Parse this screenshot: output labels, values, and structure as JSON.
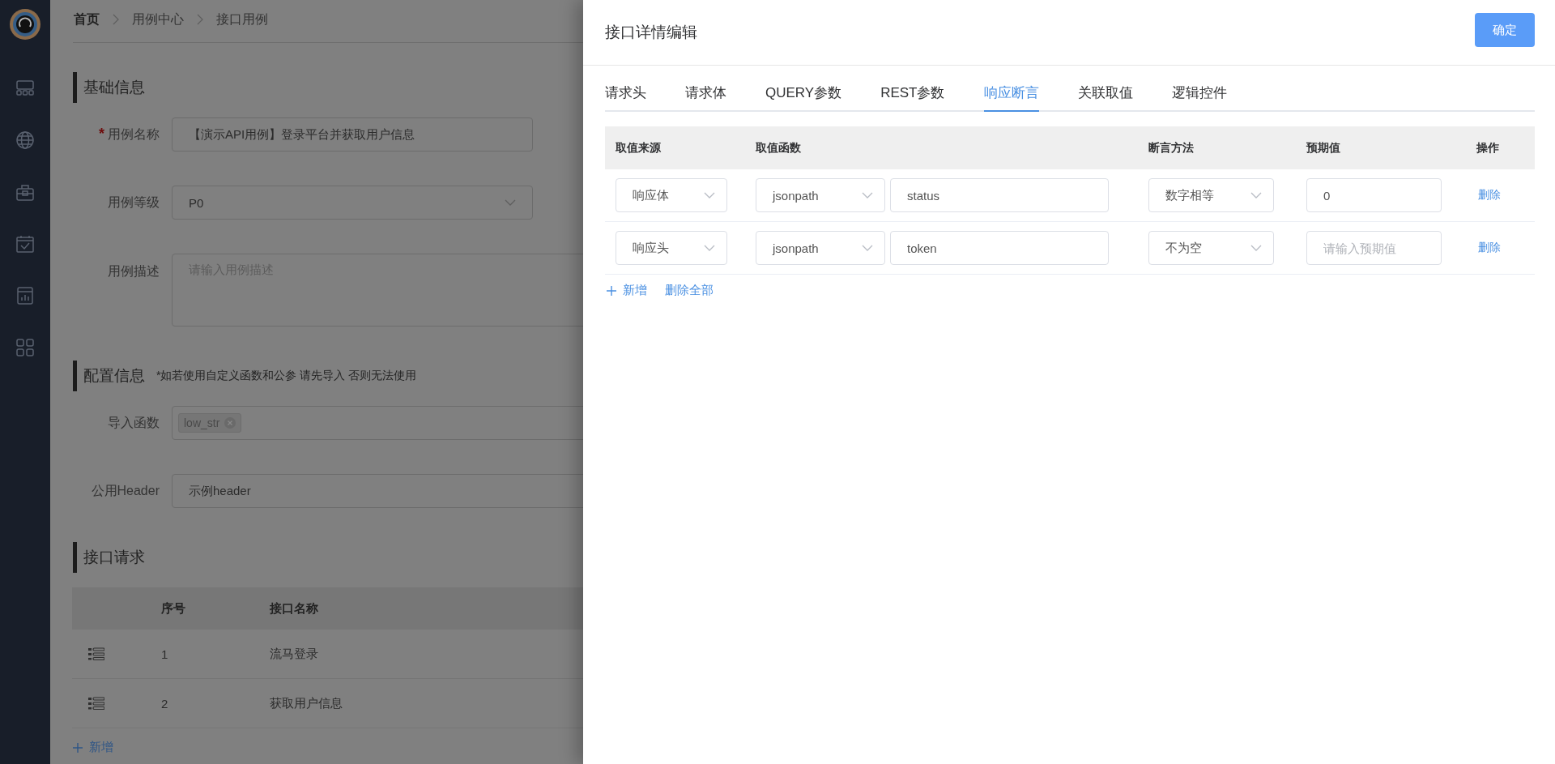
{
  "required_mark": "*",
  "breadcrumb": [
    {
      "label": "首页",
      "link": true
    },
    {
      "label": "用例中心",
      "link": false
    },
    {
      "label": "接口用例",
      "link": false
    }
  ],
  "sections": [
    {
      "kind": "form",
      "title": "基础信息",
      "fields": [
        {
          "kind": "input",
          "label": "用例名称",
          "required": true,
          "value": "【演示API用例】登录平台并获取用户信息",
          "wide": false
        },
        {
          "kind": "select",
          "label": "用例等级",
          "required": false,
          "value": "P0",
          "wide": false
        },
        {
          "kind": "textarea",
          "label": "用例描述",
          "required": false,
          "placeholder": "请输入用例描述",
          "wide": true
        }
      ]
    },
    {
      "kind": "form",
      "title": "配置信息",
      "note": "*如若使用自定义函数和公参 请先导入 否则无法使用",
      "fields": [
        {
          "kind": "tags",
          "label": "导入函数",
          "required": false,
          "tags": [
            "low_str"
          ],
          "wide": true
        },
        {
          "kind": "input",
          "label": "公用Header",
          "required": false,
          "value": "示例header",
          "wide": true
        }
      ]
    },
    {
      "kind": "table",
      "title": "接口请求",
      "columns": [
        "序号",
        "接口名称"
      ],
      "rows": [
        {
          "index": "1",
          "name": "流马登录"
        },
        {
          "index": "2",
          "name": "获取用户信息"
        }
      ],
      "add_link": "新增"
    }
  ],
  "drawer": {
    "title": "接口详情编辑",
    "confirm_button": "确定",
    "tabs": [
      {
        "label": "请求头",
        "selected": false
      },
      {
        "label": "请求体",
        "selected": false
      },
      {
        "label": "QUERY参数",
        "selected": false
      },
      {
        "label": "REST参数",
        "selected": false
      },
      {
        "label": "响应断言",
        "selected": true
      },
      {
        "label": "关联取值",
        "selected": false
      },
      {
        "label": "逻辑控件",
        "selected": false
      }
    ],
    "table": {
      "columns": [
        "取值来源",
        "取值函数",
        "断言方法",
        "预期值",
        "操作"
      ],
      "rows": [
        {
          "source": "响应体",
          "function": "jsonpath",
          "expression": "status",
          "method": "数字相等",
          "expected": "0",
          "action": "删除"
        },
        {
          "source": "响应头",
          "function": "jsonpath",
          "expression": "token",
          "method": "不为空",
          "expected_placeholder": "请输入预期值",
          "action": "删除"
        }
      ]
    },
    "add_link": "新增",
    "delete_all_link": "删除全部"
  }
}
